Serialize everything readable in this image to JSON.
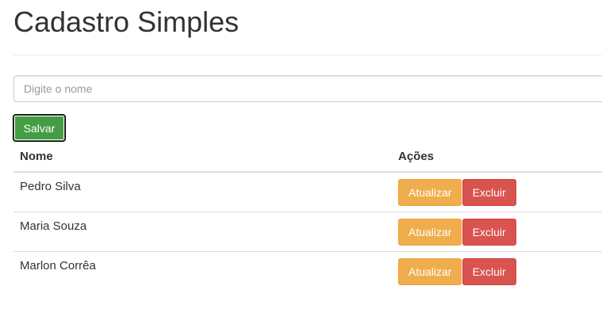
{
  "page": {
    "title": "Cadastro Simples"
  },
  "form": {
    "name_placeholder": "Digite o nome",
    "name_value": "",
    "save_label": "Salvar"
  },
  "table": {
    "headers": {
      "name": "Nome",
      "actions": "Ações"
    },
    "rows": [
      {
        "name": "Pedro Silva",
        "update_label": "Atualizar",
        "delete_label": "Excluir"
      },
      {
        "name": "Maria Souza",
        "update_label": "Atualizar",
        "delete_label": "Excluir"
      },
      {
        "name": "Marlon Corrêa",
        "update_label": "Atualizar",
        "delete_label": "Excluir"
      }
    ]
  },
  "colors": {
    "save": "#449d44",
    "update": "#f0ad4e",
    "delete": "#d9534f"
  }
}
